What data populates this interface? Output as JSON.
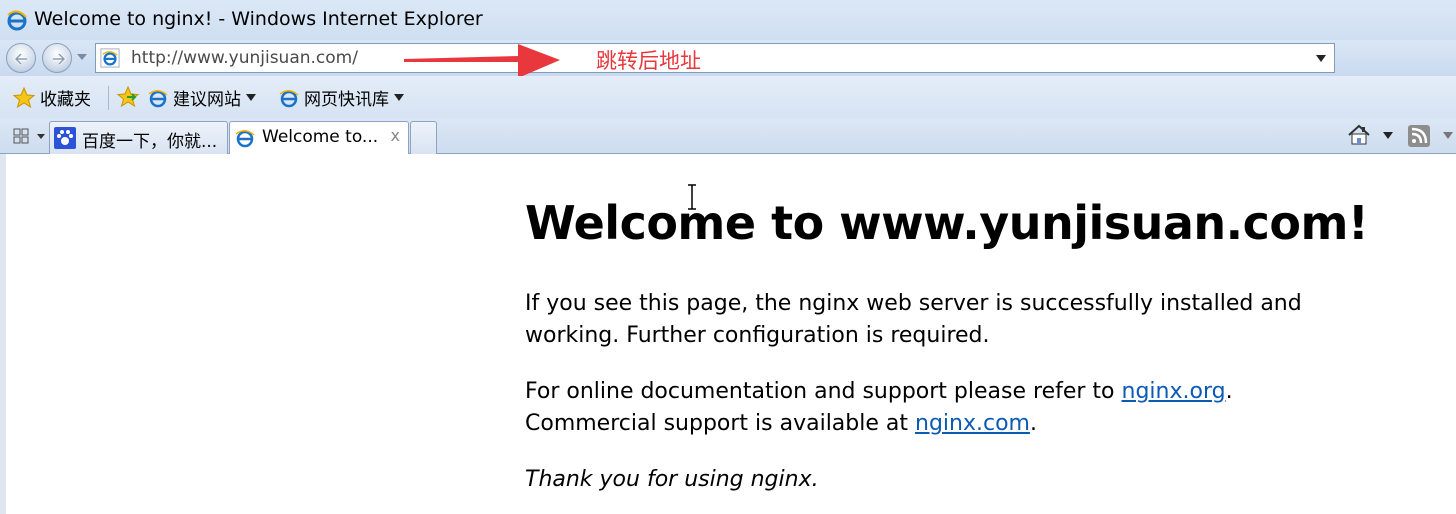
{
  "window": {
    "title": "Welcome to nginx! - Windows Internet Explorer"
  },
  "address_bar": {
    "url": "http://www.yunjisuan.com/",
    "annotation": "跳转后地址"
  },
  "favorites_bar": {
    "favorites_label": "收藏夹",
    "suggested_sites_label": "建议网站",
    "web_slice_label": "网页快讯库"
  },
  "tabs": [
    {
      "label": "百度一下，你就...",
      "icon": "baidu-paw-icon"
    },
    {
      "label": "Welcome to...",
      "icon": "ie-icon",
      "close": "x"
    }
  ],
  "page": {
    "heading": "Welcome to www.yunjisuan.com!",
    "p1": "If you see this page, the nginx web server is successfully installed and working. Further configuration is required.",
    "p2_before": "For online documentation and support please refer to ",
    "link1": "nginx.org",
    "p2_mid": ".",
    "p2_line2": "Commercial support is available at ",
    "link2": "nginx.com",
    "p2_end": ".",
    "p3": "Thank you for using nginx."
  },
  "colors": {
    "annotation": "#e8383d",
    "link": "#0b5bb5"
  }
}
